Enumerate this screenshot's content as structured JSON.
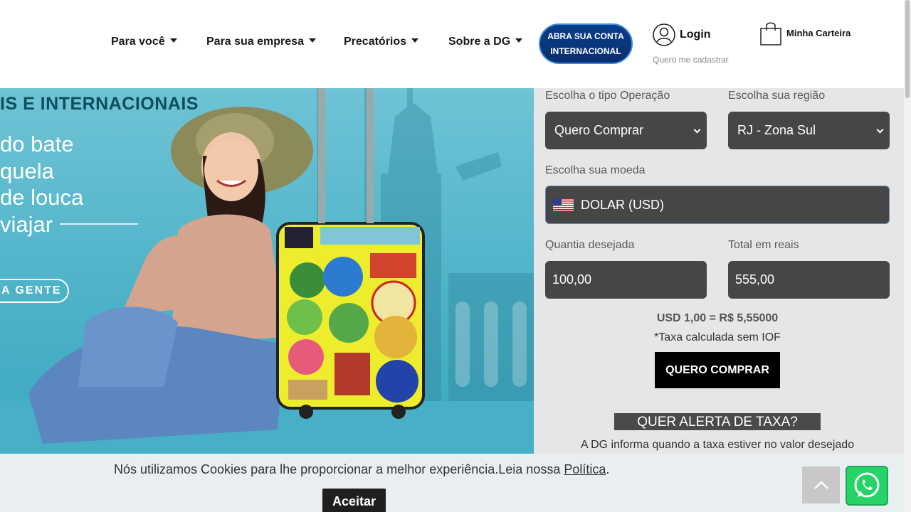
{
  "nav": {
    "items": [
      {
        "label": "Para você"
      },
      {
        "label": "Para sua empresa"
      },
      {
        "label": "Precatórios"
      },
      {
        "label": "Sobre a DG"
      }
    ],
    "intl_account_line1": "ABRA SUA CONTA",
    "intl_account_line2": "INTERNACIONAL",
    "login_label": "Login",
    "register_label": "Quero me cadastrar",
    "wallet_label": "Minha Carteira"
  },
  "hero": {
    "heading": "IS E INTERNACIONAIS",
    "tagline_lines": [
      "do bate",
      "quela",
      "de louca",
      "viajar"
    ],
    "cta_label": "A GENTE",
    "colors": {
      "background": "#4fb3c8",
      "heading": "#0e4f5d"
    }
  },
  "form": {
    "operation_label": "Escolha o tipo Operação",
    "operation_value": "Quero Comprar",
    "region_label": "Escolha sua região",
    "region_value": "RJ - Zona Sul",
    "currency_label": "Escolha sua moeda",
    "currency_value": "DOLAR (USD)",
    "currency_flag": "us-flag-icon",
    "quantity_label": "Quantia desejada",
    "quantity_value": "100,00",
    "total_label": "Total em reais",
    "total_value": "555,00",
    "rate_text": "USD 1,00 = R$ 5,55000",
    "rate_note": "*Taxa calculada sem IOF",
    "buy_button": "QUERO COMPRAR",
    "alert_title": "QUER ALERTA DE TAXA?",
    "alert_description": "A DG informa quando a taxa estiver no valor desejado"
  },
  "cookie": {
    "text": "Nós utilizamos Cookies para lhe proporcionar a melhor experiência.Leia nossa ",
    "link_label": "Política",
    "suffix": ".",
    "accept_label": "Aceitar"
  },
  "floating": {
    "back_to_top_icon": "chevron-up-icon",
    "whatsapp_icon": "whatsapp-icon"
  }
}
